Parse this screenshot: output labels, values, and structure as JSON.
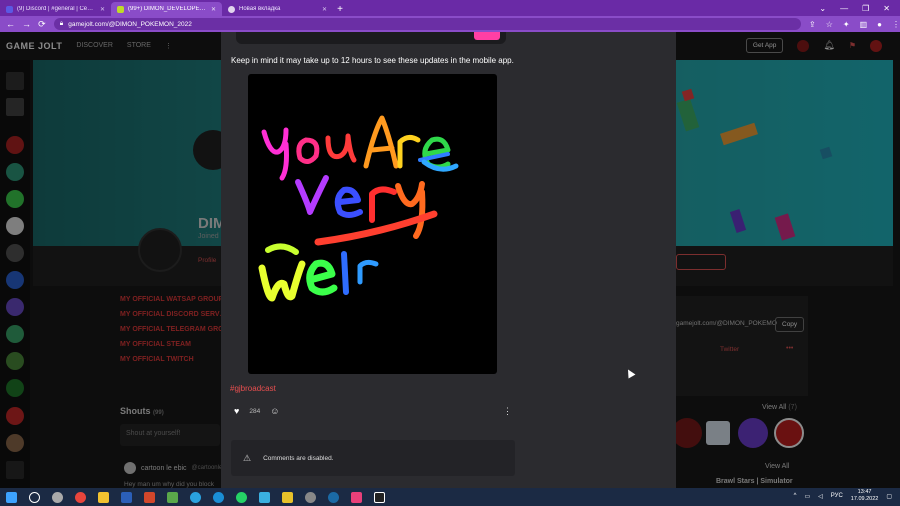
{
  "browser": {
    "tabs": [
      {
        "title": "(9) Discord | #general | Сервер д…",
        "active": false,
        "color": "#5865f2"
      },
      {
        "title": "(99+) DIMON_DEVELOPER_OFFI…",
        "active": true,
        "color": "#ccff00"
      },
      {
        "title": "Новая вкладка",
        "active": false,
        "color": "#ffffff"
      }
    ],
    "new_tab_label": "+",
    "url": "gamejolt.com/@DIMON_POKEMON_2022",
    "nav": {
      "back": "←",
      "forward": "→",
      "reload": "⟳"
    }
  },
  "gamejolt": {
    "logo": "GAME JOLT",
    "nav": [
      "DISCOVER",
      "STORE"
    ],
    "get_app": "Get App",
    "profile_name": "DIM",
    "joined": "Joined",
    "profile_tab": "Profile",
    "links": [
      "MY OFFICIAL WATSAP GROUP",
      "MY OFFICIAL DISCORD SERV…",
      "MY OFFICIAL TELEGRAM GROUP",
      "MY OFFICIAL STEAM",
      "MY OFFICIAL TWITCH"
    ],
    "shouts": "Shouts",
    "shouts_count": "(99)",
    "shout_placeholder": "Shout at yourself!",
    "comment_user": "cartoon le ebic",
    "comment_handle": "@cartoonleebic",
    "comment_text": "Hey man um why did you block",
    "share_url": "gamejolt.com/@DIMON_POKEMO",
    "copy": "Copy",
    "twitter": "Twitter",
    "more": "•••",
    "view_all": "View All",
    "view_all_count": "(7)",
    "game_title": "Brawl Stars | Simulator"
  },
  "post": {
    "note": "Keep in mind it may take up to 12 hours to see these updates in the mobile app.",
    "image_text_lines": [
      "you Are",
      "Very",
      "Wel"
    ],
    "hashtag": "#gjbroadcast",
    "like_count": "284",
    "comments_disabled": "Comments are disabled."
  },
  "taskbar": {
    "tray_lang": "РУС",
    "time": "13:47",
    "date": "17.09.2022"
  },
  "colors": {
    "browser_purple": "#6a2aa6",
    "accent_red": "#e84f4f",
    "modal_bg": "#2b2b2f"
  }
}
